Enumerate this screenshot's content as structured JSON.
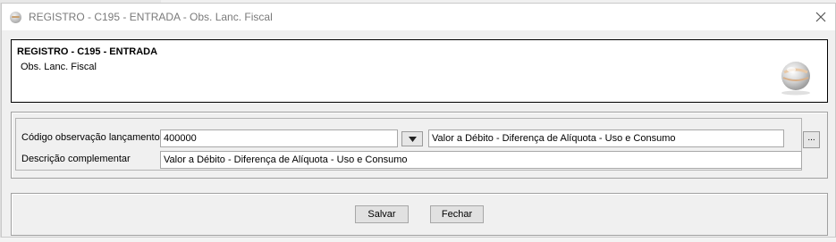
{
  "window": {
    "title": "REGISTRO - C195 - ENTRADA - Obs. Lanc. Fiscal",
    "icon": "app-globe-icon",
    "close_icon": "close-icon"
  },
  "header": {
    "title": "REGISTRO - C195 - ENTRADA",
    "subtitle": "Obs. Lanc. Fiscal",
    "logo": "globe-logo-icon"
  },
  "form": {
    "codigo_label": "Código observação lançamento",
    "codigo_value": "400000",
    "codigo_description": "Valor a Débito - Diferença de Alíquota - Uso e Consumo",
    "ellipsis_label": "...",
    "descricao_label": "Descrição complementar",
    "descricao_value": "Valor a Débito - Diferença de Alíquota - Uso e Consumo"
  },
  "buttons": {
    "save": "Salvar",
    "close": "Fechar"
  }
}
